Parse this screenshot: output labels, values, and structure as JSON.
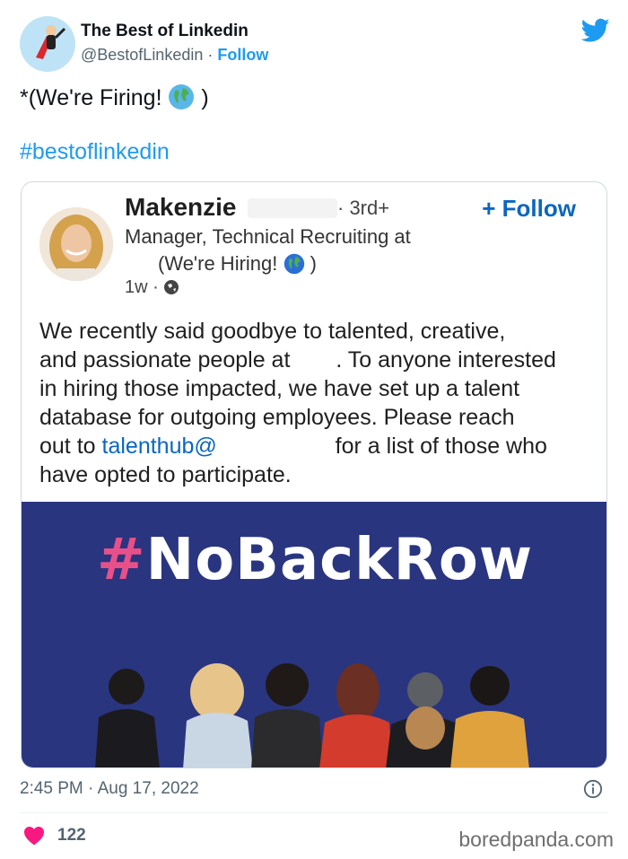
{
  "tweet": {
    "author_name": "The Best of Linkedin",
    "author_handle": "@BestofLinkedin",
    "separator": "·",
    "follow_label": "Follow",
    "text_prefix": "*(We're Firing!",
    "text_suffix": ")",
    "hashtag": "#bestoflinkedin",
    "timestamp": "2:45 PM · Aug 17, 2022",
    "like_count": "122",
    "icons": {
      "platform": "twitter-bird-icon",
      "info": "info-icon",
      "like": "heart-icon",
      "emoji": "globe-emoji"
    },
    "colors": {
      "accent": "#1d9bf0",
      "like": "#f91880"
    }
  },
  "linkedin_post": {
    "name": "Makenzie",
    "degree": "· 3rd+",
    "follow_label": "+ Follow",
    "headline": "Manager, Technical Recruiting at",
    "hiring_text": "(We're Hiring!",
    "hiring_suffix": ")",
    "time": "1w ·",
    "body_lines": [
      "We recently said goodbye to talented, creative,",
      "and passionate people at",
      ". To anyone interested",
      "in hiring those impacted, we have set up a talent",
      "database for outgoing employees. Please reach",
      "out to",
      "talenthub@",
      "for a list of those who",
      "have opted to participate."
    ],
    "campaign_hash": "#",
    "campaign_word": "NoBackRow",
    "colors": {
      "link": "#0a66c2",
      "image_bg": "#2a3580",
      "hash": "#e8508a"
    }
  },
  "watermark": "boredpanda.com"
}
